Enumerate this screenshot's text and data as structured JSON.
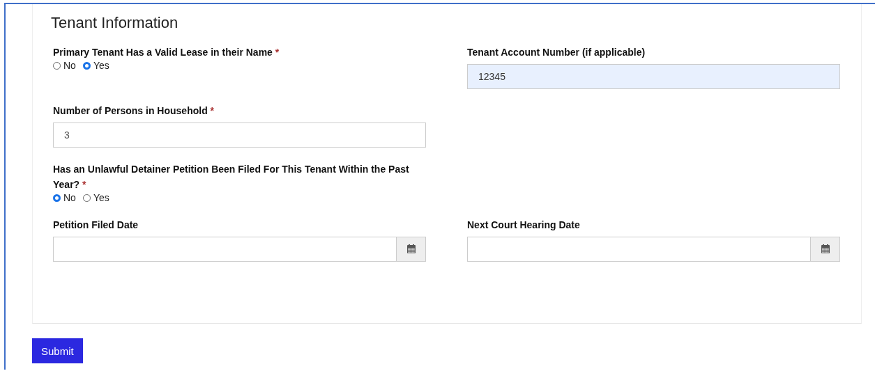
{
  "section": {
    "title": "Tenant Information"
  },
  "rows": [
    [
      {
        "kind": "radio",
        "label": "Primary Tenant Has a Valid Lease in their Name",
        "required_mark": "*",
        "options": [
          {
            "label": "No",
            "selected": false
          },
          {
            "label": "Yes",
            "selected": true
          }
        ]
      },
      {
        "kind": "text",
        "label": "Tenant Account Number (if applicable)",
        "value": "12345",
        "autofilled": true
      }
    ],
    [
      {
        "kind": "text",
        "label": "Number of Persons in Household",
        "required_mark": "*",
        "value": "3",
        "autofilled": false
      }
    ],
    [
      {
        "kind": "radio",
        "label": "Has an Unlawful Detainer Petition Been Filed For This Tenant Within the Past Year?",
        "required_mark": "*",
        "options": [
          {
            "label": "No",
            "selected": true
          },
          {
            "label": "Yes",
            "selected": false
          }
        ]
      }
    ],
    [
      {
        "kind": "date",
        "label": "Petition Filed Date"
      },
      {
        "kind": "date",
        "label": "Next Court Hearing Date"
      }
    ]
  ],
  "submit_button": "Submit"
}
